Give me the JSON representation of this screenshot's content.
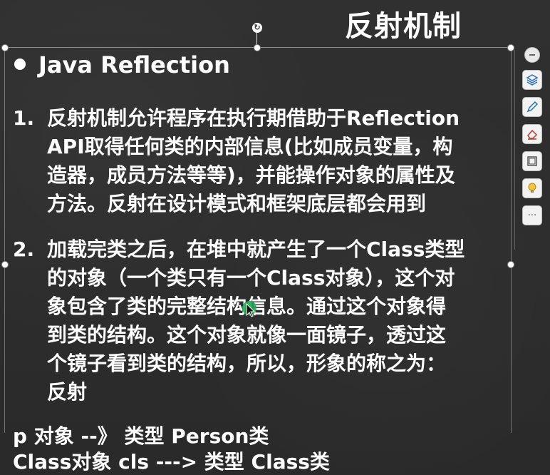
{
  "slide": {
    "title": "反射机制",
    "heading": "Java Reflection",
    "point1": {
      "number": "1.",
      "lines": [
        "反射机制允许程序在执行期借助于Reflection",
        "API取得任何类的内部信息(比如成员变量，构",
        "造器，成员方法等等)，并能操作对象的属性及",
        "方法。反射在设计模式和框架底层都会用到"
      ]
    },
    "point2": {
      "number": "2.",
      "lines": [
        "加载完类之后，在堆中就产生了一个Class类型",
        "的对象（一个类只有一个Class对象），这个对",
        "象包含了类的完整结构信息。通过这个对象得",
        "到类的结构。这个对象就像一面镜子，透过这",
        "个镜子看到类的结构，所以，形象的称之为：",
        "反射"
      ]
    },
    "footer": [
      "p 对象  --》 类型 Person类",
      "Class对象 cls --->  类型 Class类"
    ]
  },
  "toolbar": {
    "tools": [
      "minus-icon",
      "layers-icon",
      "pen-icon",
      "eraser-icon",
      "frame-icon",
      "bulb-icon",
      "more-icon"
    ],
    "more_label": "···"
  },
  "colors": {
    "background": "#2d2d2d",
    "text": "#ffffff",
    "cursor": "#1fa84f"
  }
}
